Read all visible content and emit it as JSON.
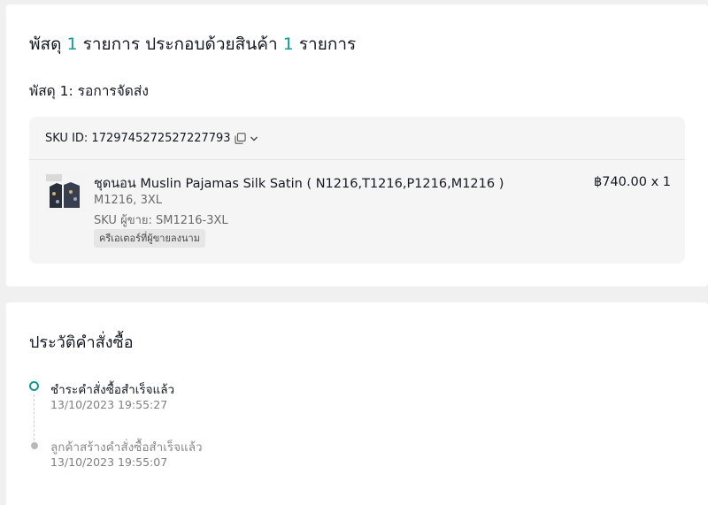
{
  "package": {
    "title_prefix": "พัสดุ",
    "package_count": "1",
    "title_middle": "รายการ ประกอบด้วยสินค้า",
    "item_count": "1",
    "title_suffix": "รายการ",
    "subtitle": "พัสดุ 1: รอการจัดส่ง",
    "sku_id_label": "SKU ID: 1729745272527227793",
    "item": {
      "name": "ชุดนอน Muslin Pajamas Silk Satin ( N1216,T1216,P1216,M1216 )",
      "variant": "M1216, 3XL",
      "seller_sku": "SKU ผู้ขาย: SM1216-3XL",
      "tag": "ครีเอเตอร์ที่ผู้ขายลงนาม",
      "price_qty": "฿740.00 x 1"
    }
  },
  "history": {
    "title": "ประวัติคำสั่งซื้อ",
    "events": [
      {
        "label": "ชำระคำสั่งซื้อสำเร็จแล้ว",
        "time": "13/10/2023 19:55:27"
      },
      {
        "label": "ลูกค้าสร้างคำสั่งซื้อสำเร็จแล้ว",
        "time": "13/10/2023 19:55:07"
      }
    ]
  },
  "colors": {
    "accent": "#129990",
    "background": "#f0f0f0",
    "card": "#ffffff",
    "sku_box": "#f5f5f5"
  },
  "icons": [
    "copy-icon",
    "chevron-down-icon",
    "product-thumbnail"
  ]
}
